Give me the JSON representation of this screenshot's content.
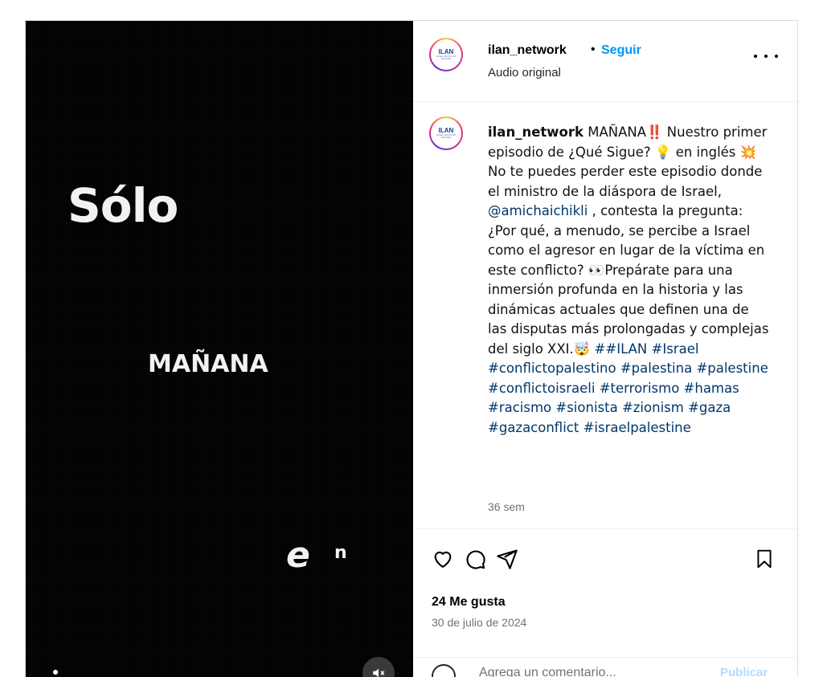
{
  "media": {
    "overlay_text": {
      "line1": "Sólo",
      "line2": "MAÑANA",
      "line3a": "e",
      "line3b": "n"
    },
    "mute_icon": "speaker-muted-icon"
  },
  "header": {
    "username": "ilan_network",
    "separator": "•",
    "follow_label": "Seguir",
    "audio_label": "Audio original",
    "avatar_logo": "ILAN",
    "avatar_sub": "ISRAEL INNOVATION NETWORK",
    "more_icon": "more-options-icon"
  },
  "caption": {
    "username": "ilan_network",
    "text_1": " MAÑANA‼️ Nuestro primer episodio de ¿Qué Sigue? 💡 en inglés 💥 No te puedes perder este episodio donde el ministro de la diáspora de Israel, ",
    "mention": "@amichaichikli",
    "text_2": " , contesta la pregunta: ¿Por qué, a menudo, se percibe a Israel como el agresor en lugar de la víctima en este conflicto? 👀Prepárate para una inmersión profunda en la historia y las dinámicas actuales que definen una de las disputas más prolongadas y complejas del siglo XXI.🤯 ",
    "hashtags": "##ILAN #Israel #conflictopalestino #palestina #palestine #conflictoisraeli #terrorismo #hamas #racismo #sionista #zionism #gaza #gazaconflict #israelpalestine",
    "time_ago": "36 sem"
  },
  "actions": {
    "like_icon": "heart-icon",
    "comment_icon": "comment-icon",
    "share_icon": "share-icon",
    "save_icon": "bookmark-icon",
    "likes": "24 Me gusta",
    "date": "30 de julio de 2024"
  },
  "comment": {
    "emoji_icon": "emoji-icon",
    "placeholder": "Agrega un comentario...",
    "publish_label": "Publicar"
  }
}
